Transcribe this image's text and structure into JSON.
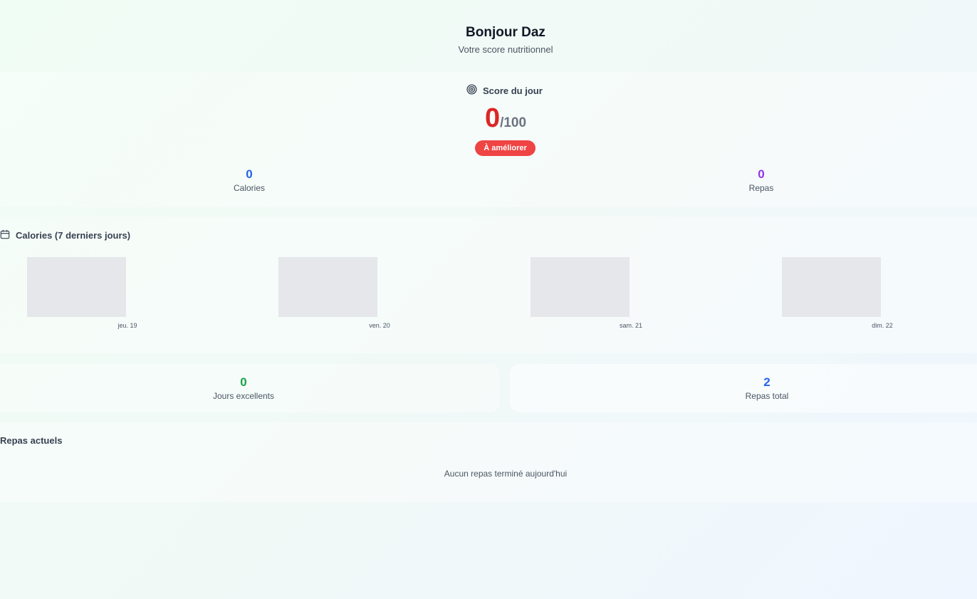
{
  "header": {
    "greeting": "Bonjour Daz",
    "subtitle": "Votre score nutritionnel"
  },
  "score": {
    "title": "Score du jour",
    "title_icon": "target-icon",
    "value": "0",
    "max": "/100",
    "badge": "À améliorer",
    "stats": [
      {
        "value": "0",
        "label": "Calories",
        "color": "#2563eb"
      },
      {
        "value": "0",
        "label": "Repas",
        "color": "#9333ea"
      }
    ]
  },
  "calories": {
    "title": "Calories (7 derniers jours)",
    "title_icon": "calendar-icon",
    "chart_data": {
      "type": "bar",
      "categories": [
        "jeu. 19",
        "ven. 20",
        "sam. 21",
        "dim. 22"
      ],
      "values": [
        0,
        0,
        0,
        0
      ],
      "title": "Calories (7 derniers jours)",
      "xlabel": "",
      "ylabel": ""
    }
  },
  "summary": [
    {
      "value": "0",
      "label": "Jours excellents",
      "color": "#16a34a"
    },
    {
      "value": "2",
      "label": "Repas total",
      "color": "#2563eb"
    }
  ],
  "meals": {
    "title": "Repas actuels",
    "empty_text": "Aucun repas terminé aujourd'hui"
  },
  "colors": {
    "score_value": "#dc2626",
    "badge_bg": "#ef4444",
    "bar_empty": "#e5e7eb"
  }
}
